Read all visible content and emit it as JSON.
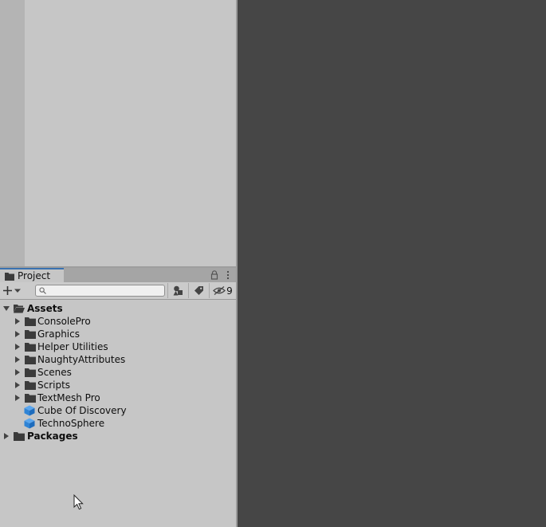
{
  "project_window": {
    "tab_label": "Project",
    "search": {
      "value": "",
      "placeholder": ""
    },
    "hidden_packages_count": "9"
  },
  "tree": {
    "assets": {
      "label": "Assets",
      "children": [
        {
          "label": "ConsolePro",
          "icon": "folder-icon"
        },
        {
          "label": "Graphics",
          "icon": "folder-icon"
        },
        {
          "label": "Helper Utilities",
          "icon": "folder-icon"
        },
        {
          "label": "NaughtyAttributes",
          "icon": "folder-icon"
        },
        {
          "label": "Scenes",
          "icon": "folder-icon"
        },
        {
          "label": "Scripts",
          "icon": "folder-icon"
        },
        {
          "label": "TextMesh Pro",
          "icon": "folder-icon"
        },
        {
          "label": "Cube Of Discovery",
          "icon": "prefab-icon"
        },
        {
          "label": "TechnoSphere",
          "icon": "prefab-icon"
        }
      ]
    },
    "packages": {
      "label": "Packages"
    }
  },
  "colors": {
    "panel": "#c6c6c6",
    "scene_background": "#464646",
    "tab_accent": "#3a72b0",
    "prefab_blue": "#2f84d6",
    "folder": "#3b3b3b"
  }
}
